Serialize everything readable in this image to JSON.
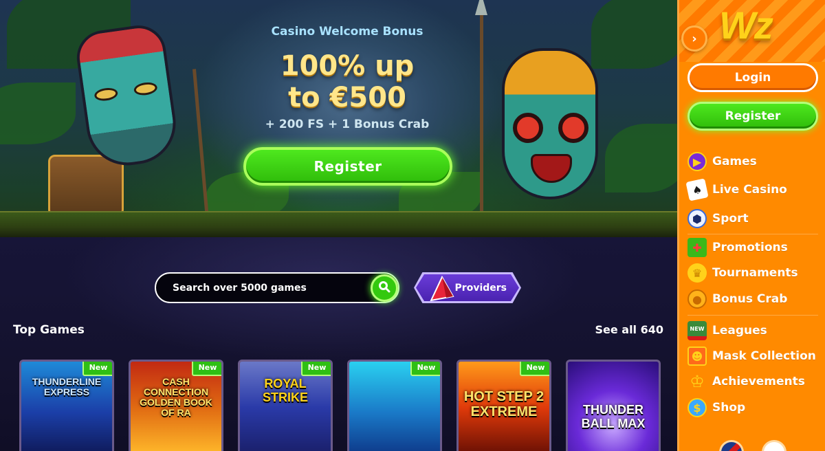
{
  "hero": {
    "subtitle": "Casino Welcome Bonus",
    "amount_line1": "100% up",
    "amount_line2": "to €500",
    "extra": "+ 200 FS + 1 Bonus Crab",
    "register_label": "Register"
  },
  "search": {
    "placeholder": "Search over 5000 games"
  },
  "providers_label": "Providers",
  "top_games": {
    "title": "Top Games",
    "see_all": "See all 640",
    "items": [
      {
        "title": "THUNDERLINE EXPRESS",
        "badge": "New"
      },
      {
        "title": "CASH CONNECTION GOLDEN BOOK OF RA",
        "badge": "New"
      },
      {
        "title": "ROYAL STRIKE",
        "badge": "New"
      },
      {
        "title": "",
        "badge": "New"
      },
      {
        "title": "HOT STEP 2 EXTREME",
        "badge": "New"
      },
      {
        "title": "THUNDER BALL MAX",
        "badge": ""
      }
    ]
  },
  "sidebar": {
    "logo": "Wz",
    "login_label": "Login",
    "register_label": "Register",
    "items": [
      {
        "label": "Games",
        "icon": "play-icon",
        "color": "#7a2ad8"
      },
      {
        "label": "Live Casino",
        "icon": "cards-icon",
        "color": "#ffffff"
      },
      {
        "label": "Sport",
        "icon": "soccer-ball-icon",
        "color": "#3a6ad8"
      },
      {
        "label": "Promotions",
        "icon": "gift-icon",
        "color": "#3ab81a"
      },
      {
        "label": "Tournaments",
        "icon": "trophy-icon",
        "color": "#ffd21a"
      },
      {
        "label": "Bonus Crab",
        "icon": "coin-icon",
        "color": "#ffb21a"
      },
      {
        "label": "Leagues",
        "icon": "leagues-icon",
        "color": "#d81a1a"
      },
      {
        "label": "Mask Collection",
        "icon": "mask-icon",
        "color": "#ff6a1a"
      },
      {
        "label": "Achievements",
        "icon": "crown-icon",
        "color": "#ffd21a"
      },
      {
        "label": "Shop",
        "icon": "shop-icon",
        "color": "#3aa8ff"
      }
    ]
  },
  "colors": {
    "accent_orange": "#ff8a00",
    "accent_green": "#34c90f",
    "background": "#120f2a"
  }
}
